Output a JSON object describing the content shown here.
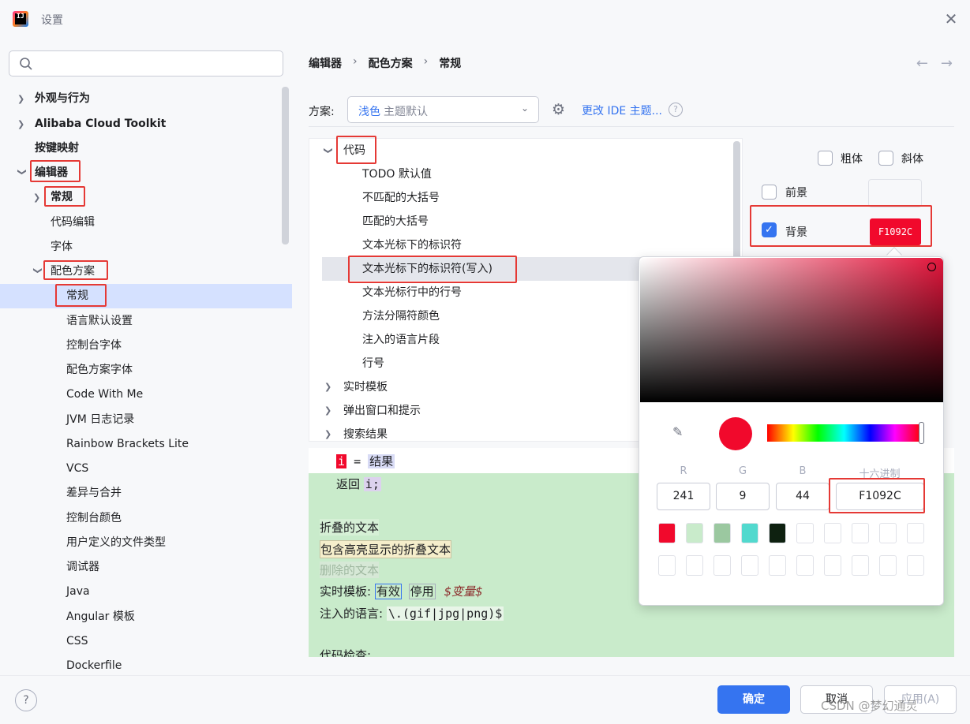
{
  "window": {
    "title": "设置"
  },
  "sidebar": {
    "search_placeholder": "",
    "items": [
      {
        "label": "外观与行为"
      },
      {
        "label": "Alibaba Cloud Toolkit"
      },
      {
        "label": "按键映射"
      },
      {
        "label": "编辑器"
      },
      {
        "label": "常规"
      },
      {
        "label": "代码编辑"
      },
      {
        "label": "字体"
      },
      {
        "label": "配色方案"
      },
      {
        "label": "常规"
      },
      {
        "label": "语言默认设置"
      },
      {
        "label": "控制台字体"
      },
      {
        "label": "配色方案字体"
      },
      {
        "label": "Code With Me"
      },
      {
        "label": "JVM 日志记录"
      },
      {
        "label": "Rainbow Brackets Lite"
      },
      {
        "label": "VCS"
      },
      {
        "label": "差异与合并"
      },
      {
        "label": "控制台颜色"
      },
      {
        "label": "用户定义的文件类型"
      },
      {
        "label": "调试器"
      },
      {
        "label": "Java"
      },
      {
        "label": "Angular 模板"
      },
      {
        "label": "CSS"
      },
      {
        "label": "Dockerfile"
      }
    ]
  },
  "breadcrumb": [
    "编辑器",
    "配色方案",
    "常规"
  ],
  "scheme": {
    "label": "方案:",
    "value": "浅色",
    "hint": "主题默认",
    "change_ide_link": "更改 IDE 主题..."
  },
  "code_tree": {
    "items": [
      {
        "label": "代码"
      },
      {
        "label": "TODO 默认值"
      },
      {
        "label": "不匹配的大括号"
      },
      {
        "label": "匹配的大括号"
      },
      {
        "label": "文本光标下的标识符"
      },
      {
        "label": "文本光标下的标识符(写入)"
      },
      {
        "label": "文本光标行中的行号"
      },
      {
        "label": "方法分隔符颜色"
      },
      {
        "label": "注入的语言片段"
      },
      {
        "label": "行号"
      },
      {
        "label": "实时模板"
      },
      {
        "label": "弹出窗口和提示"
      },
      {
        "label": "搜索结果"
      }
    ]
  },
  "props": {
    "bold_label": "粗体",
    "italic_label": "斜体",
    "foreground_label": "前景",
    "background_label": "背景",
    "background_hex": "F1092C",
    "background_color": "#F1092C"
  },
  "preview": {
    "line1_var": "i",
    "line1_eq": "=",
    "line1_result": "结果",
    "line2_return": "返回",
    "line2_var": "i;",
    "folded_text": "折叠的文本",
    "folded_highlight_text": "包含高亮显示的折叠文本",
    "deleted_text": "删除的文本",
    "live_template_label": "实时模板:",
    "live_template_active": "有效",
    "live_template_inactive": "停用",
    "live_template_var": "$变量$",
    "injected_label": "注入的语言:",
    "injected_value": "\\.(gif|jpg|png)$",
    "inspection_label": "代码检查:"
  },
  "color_picker": {
    "r_label": "R",
    "g_label": "G",
    "b_label": "B",
    "hex_label": "十六进制",
    "r": "241",
    "g": "9",
    "b": "44",
    "hex": "F1092C",
    "current_color": "#F1092C",
    "recent_colors": [
      "#F1092C",
      "#C9EBCB",
      "#9BC8A0",
      "#52D9CE",
      "#0E2110"
    ]
  },
  "footer": {
    "ok": "确定",
    "cancel": "取消",
    "apply": "应用(A)",
    "watermark": "CSDN @梦幻通灵"
  },
  "colors": {
    "accent": "#3574F0",
    "annotation": "#E53935",
    "preview_background": "#C9EBCB"
  }
}
